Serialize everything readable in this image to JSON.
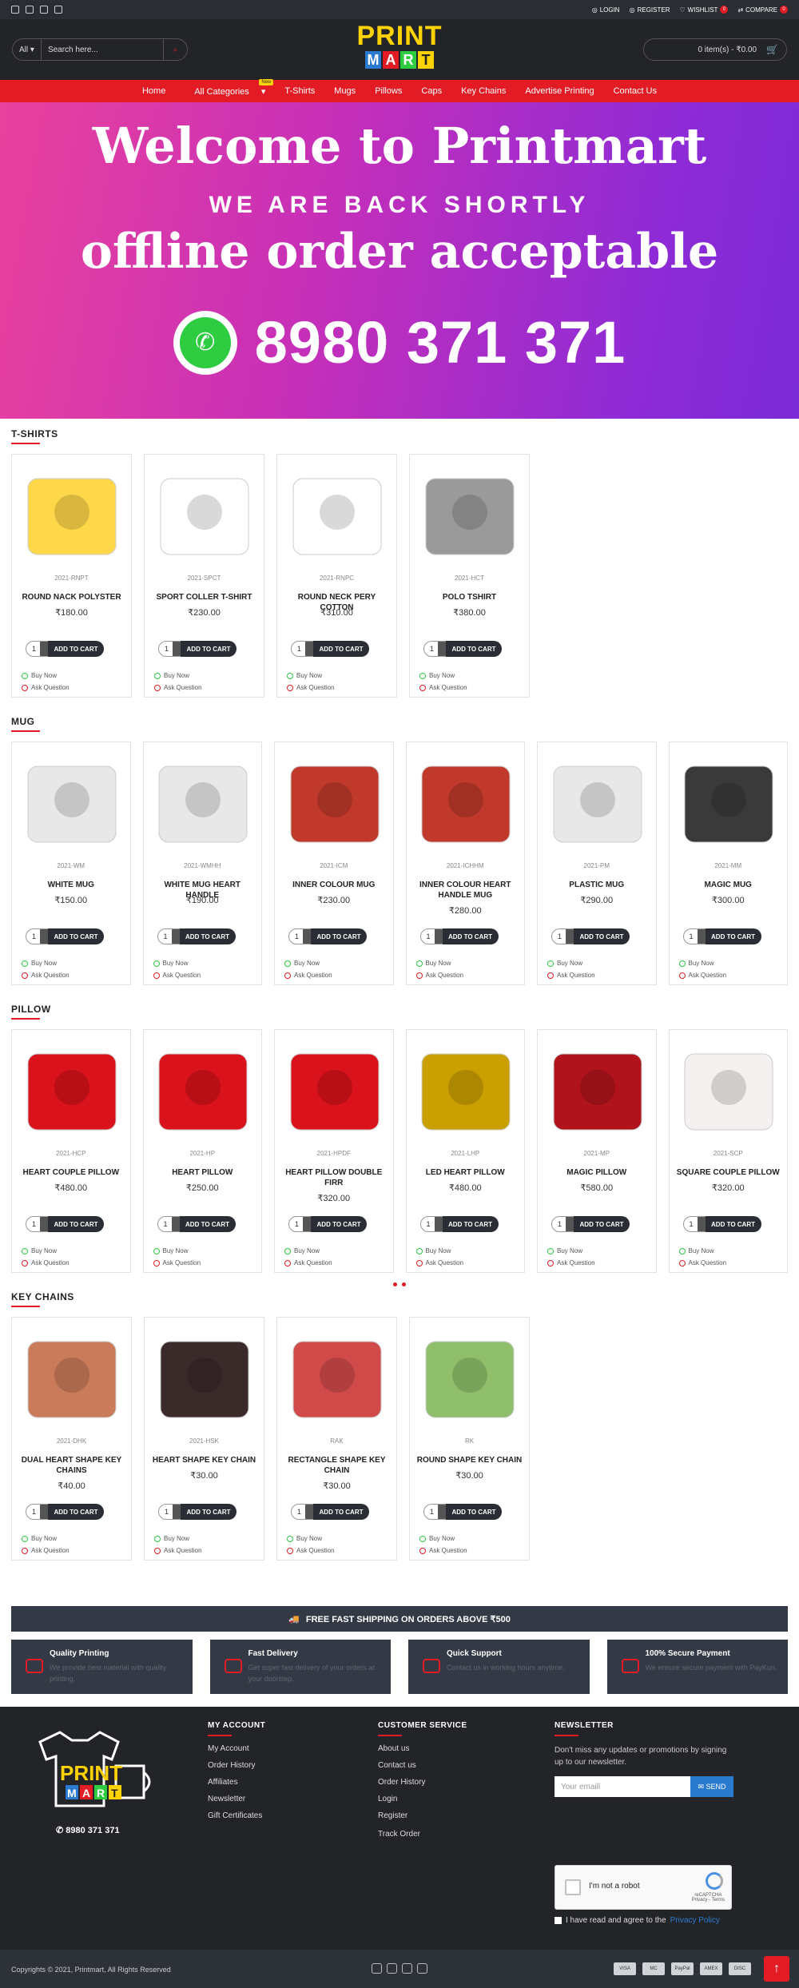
{
  "topbar": {
    "login": "LOGIN",
    "register": "REGISTER",
    "wishlist": "WISHLIST",
    "wishlist_count": "0",
    "compare": "COMPARE",
    "compare_count": "0"
  },
  "header": {
    "search_category": "All",
    "search_placeholder": "Search here...",
    "logo_top": "PRINT",
    "logo_letters": [
      "M",
      "A",
      "R",
      "T"
    ],
    "cart_text": "0 item(s) - ₹0.00"
  },
  "nav": {
    "items": [
      "Home",
      "All Categories",
      "T-Shirts",
      "Mugs",
      "Pillows",
      "Caps",
      "Key Chains",
      "Advertise Printing",
      "Contact Us"
    ],
    "new_badge": "New"
  },
  "hero": {
    "line1": "Welcome to Printmart",
    "line2": "WE ARE BACK SHORTLY",
    "line3": "offline order acceptable",
    "phone": "8980 371 371"
  },
  "common": {
    "add_to_cart": "ADD TO CART",
    "buy_now": "Buy Now",
    "ask_question": "Ask Question",
    "qty": "1"
  },
  "sections": [
    {
      "title": "T-SHIRTS",
      "products": [
        {
          "model": "2021-RNPT",
          "name": "ROUND NACK POLYSTER",
          "price": "₹180.00"
        },
        {
          "model": "2021-SPCT",
          "name": "SPORT COLLER T-SHIRT",
          "price": "₹230.00"
        },
        {
          "model": "2021-RNPC",
          "name": "ROUND NECK PERY COTTON",
          "price": "₹310.00"
        },
        {
          "model": "2021-HCT",
          "name": "POLO TSHIRT",
          "price": "₹380.00"
        }
      ]
    },
    {
      "title": "MUG",
      "products": [
        {
          "model": "2021-WM",
          "name": "WHITE MUG",
          "price": "₹150.00"
        },
        {
          "model": "2021-WMHH",
          "name": "WHITE MUG HEART HANDLE",
          "price": "₹190.00"
        },
        {
          "model": "2021-ICM",
          "name": "INNER COLOUR MUG",
          "price": "₹230.00"
        },
        {
          "model": "2021-ICHHM",
          "name": "INNER COLOUR HEART HANDLE MUG",
          "price": "₹280.00"
        },
        {
          "model": "2021-PM",
          "name": "PLASTIC MUG",
          "price": "₹290.00"
        },
        {
          "model": "2021-MM",
          "name": "MAGIC MUG",
          "price": "₹300.00"
        }
      ]
    },
    {
      "title": "PILLOW",
      "products": [
        {
          "model": "2021-HCP",
          "name": "HEART COUPLE PILLOW",
          "price": "₹480.00"
        },
        {
          "model": "2021-HP",
          "name": "HEART PILLOW",
          "price": "₹250.00"
        },
        {
          "model": "2021-HPDF",
          "name": "HEART PILLOW DOUBLE FIRR",
          "price": "₹320.00"
        },
        {
          "model": "2021-LHP",
          "name": "LED HEART PILLOW",
          "price": "₹480.00"
        },
        {
          "model": "2021-MP",
          "name": "MAGIC PILLOW",
          "price": "₹580.00"
        },
        {
          "model": "2021-SCP",
          "name": "SQUARE COUPLE PILLOW",
          "price": "₹320.00"
        }
      ]
    },
    {
      "title": "KEY CHAINS",
      "products": [
        {
          "model": "2021-DHK",
          "name": "DUAL HEART SHAPE KEY CHAINS",
          "price": "₹40.00"
        },
        {
          "model": "2021-HSK",
          "name": "HEART SHAPE KEY CHAIN",
          "price": "₹30.00"
        },
        {
          "model": "RAK",
          "name": "RECTANGLE SHAPE KEY CHAIN",
          "price": "₹30.00"
        },
        {
          "model": "RK",
          "name": "ROUND SHAPE KEY CHAIN",
          "price": "₹30.00"
        }
      ]
    }
  ],
  "shipping": "FREE FAST SHIPPING ON ORDERS ABOVE ₹500",
  "features": [
    {
      "title": "Quality Printing",
      "desc": "We provide best material with quality printing."
    },
    {
      "title": "Fast Delivery",
      "desc": "Get super fast delivery of your orders at your doorstep."
    },
    {
      "title": "Quick Support",
      "desc": "Contact us in working hours anytime."
    },
    {
      "title": "100% Secure Payment",
      "desc": "We ensure secure payment with PayKun."
    }
  ],
  "footer": {
    "phone": "8980 371 371",
    "my_account": {
      "title": "MY ACCOUNT",
      "links": [
        "My Account",
        "Order History",
        "Affiliates",
        "Newsletter",
        "Gift Certificates"
      ]
    },
    "customer_service": {
      "title": "CUSTOMER SERVICE",
      "links": [
        "About us",
        "Contact us",
        "Order History",
        "Login",
        "Register",
        "Track Order"
      ]
    },
    "newsletter": {
      "title": "NEWSLETTER",
      "text": "Don't miss any updates or promotions by signing up to our newsletter.",
      "placeholder": "Your emaill",
      "send": "SEND",
      "captcha_label": "I'm not a robot",
      "recaptcha": "reCAPTCHA",
      "recaptcha_links": "Privacy - Terms",
      "agree": "I have read and agree to the",
      "privacy": "Privacy Policy"
    }
  },
  "bottom": {
    "copyright": "Copyrights © 2021, Printmart, All Rights Reserved",
    "payments": [
      "VISA",
      "MC",
      "PayPal",
      "AMEX",
      "DISC"
    ]
  },
  "colors": {
    "accent": "#e21b24",
    "dark": "#222428",
    "panel": "#333a45"
  }
}
